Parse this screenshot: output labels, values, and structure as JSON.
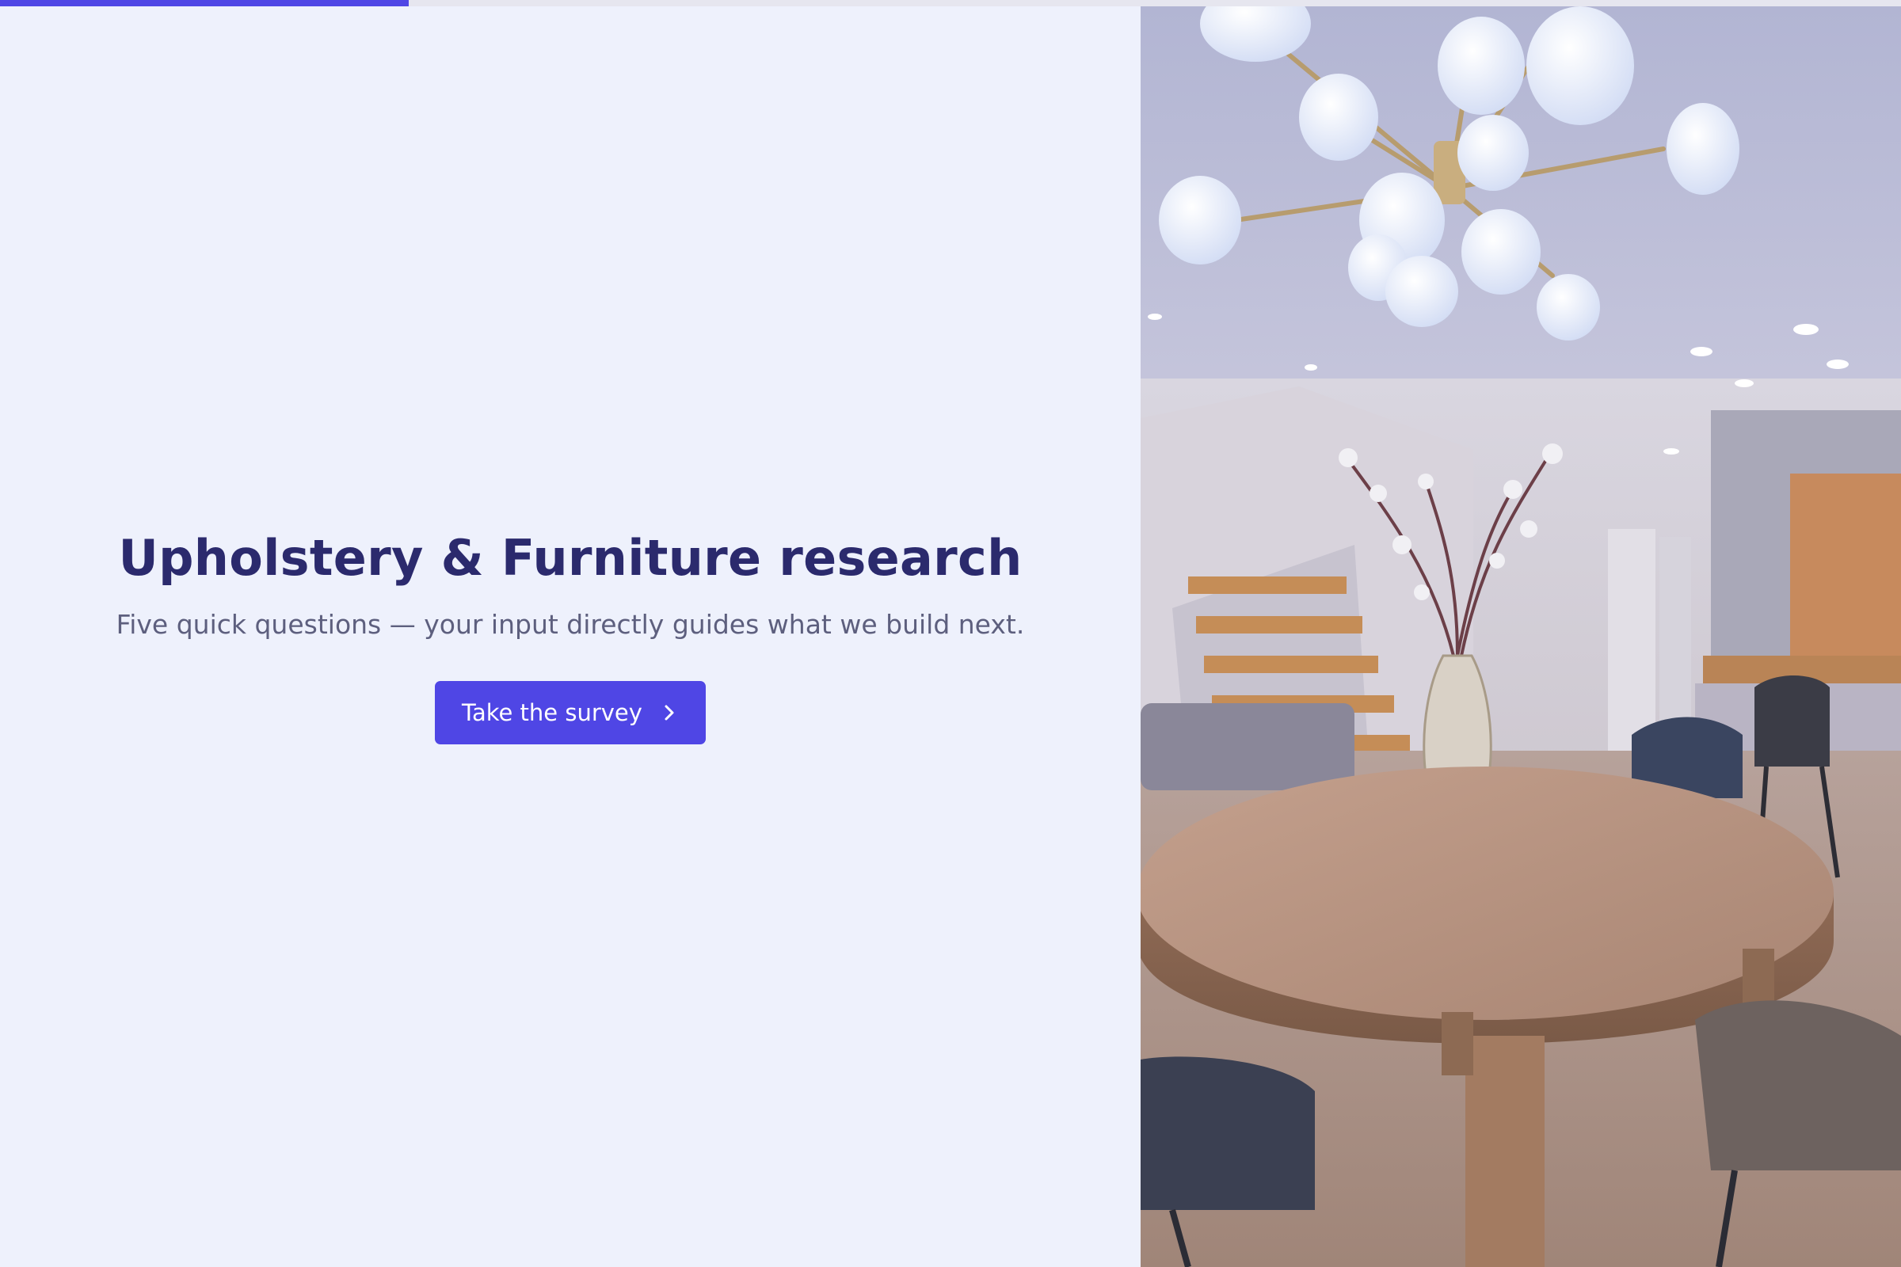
{
  "progress": {
    "fraction": 0.215,
    "fill_color": "#4f46e5",
    "track_color": "#e6e6ef"
  },
  "hero": {
    "title": "Upholstery & Furniture research",
    "subtitle": "Five quick questions — your input directly guides what we build next.",
    "cta_label": "Take the survey",
    "cta_icon": "chevron-right-icon"
  },
  "colors": {
    "accent": "#4f46e5",
    "title": "#2b2a6d",
    "subtitle": "#5d5f7e",
    "background": "#eef1fc"
  },
  "image": {
    "subject": "interior-dining-room"
  }
}
